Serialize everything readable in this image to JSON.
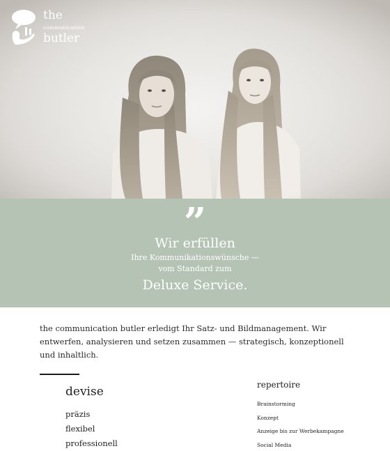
{
  "logo": {
    "the": "the",
    "communication": "communication",
    "butler": "butler"
  },
  "hero": {
    "image": "photo-two-women"
  },
  "quote": {
    "mark": "”",
    "headline": "Wir erfüllen",
    "line1": "Ihre Kommunikationswünsche —",
    "line2": "vom Standard zum",
    "tail": "Deluxe Service."
  },
  "intro": {
    "text": "the communication butler erledigt Ihr Satz- und Bildmanagement. Wir entwerfen, analysieren und setzen zusammen — strategisch, konzeptionell und inhaltlich."
  },
  "devise": {
    "title": "devise",
    "items": [
      "präzis",
      "flexibel",
      "professionell"
    ]
  },
  "repertoire": {
    "title": "repertoire",
    "items": [
      "Brainstorming",
      "Konzept",
      "Anzeige bis zur Werbekampagne",
      "Social Media"
    ]
  },
  "colors": {
    "band": "#b4c3b4",
    "hero_bg": "#e8e6e3"
  }
}
